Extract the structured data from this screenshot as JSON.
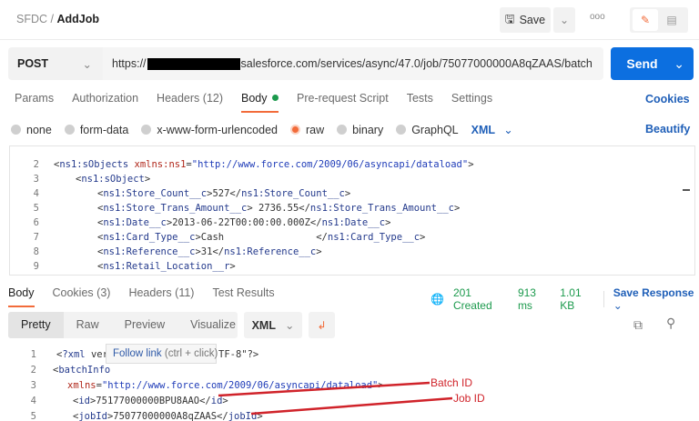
{
  "header": {
    "breadcrumb_parent": "SFDC",
    "breadcrumb_sep": "/",
    "title": "AddJob",
    "save_label": "Save"
  },
  "request": {
    "method": "POST",
    "url_prefix": "https://",
    "url_rest": "salesforce.com/services/async/47.0/job/75077000000A8qZAAS/batch",
    "send_label": "Send"
  },
  "tabs": {
    "params": "Params",
    "authorization": "Authorization",
    "headers": "Headers",
    "headers_count": "(12)",
    "body": "Body",
    "prerequest": "Pre-request Script",
    "tests": "Tests",
    "settings": "Settings",
    "cookies": "Cookies"
  },
  "body_types": {
    "none": "none",
    "form_data": "form-data",
    "urlencoded": "x-www-form-urlencoded",
    "raw": "raw",
    "binary": "binary",
    "graphql": "GraphQL",
    "language": "XML",
    "beautify": "Beautify",
    "selected": "raw"
  },
  "request_body": [
    {
      "n": "2",
      "t": "<ns1:sObjects xmlns:ns1=\"http://www.force.com/2009/06/asyncapi/dataload\">"
    },
    {
      "n": "3",
      "t": "<ns1:sObject>"
    },
    {
      "n": "4",
      "t": "<ns1:Store_Count__c>527</ns1:Store_Count__c>"
    },
    {
      "n": "5",
      "t": "<ns1:Store_Trans_Amount__c> 2736.55</ns1:Store_Trans_Amount__c>"
    },
    {
      "n": "6",
      "t": "<ns1:Date__c>2013-06-22T00:00:00.000Z</ns1:Date__c>"
    },
    {
      "n": "7",
      "t": "<ns1:Card_Type__c>Cash                </ns1:Card_Type__c>"
    },
    {
      "n": "8",
      "t": "<ns1:Reference__c>31</ns1:Reference__c>"
    },
    {
      "n": "9",
      "t": "<ns1:Retail_Location__r>"
    }
  ],
  "response_tabs": {
    "body": "Body",
    "cookies": "Cookies",
    "cookies_count": "(3)",
    "headers": "Headers",
    "headers_count": "(11)",
    "test_results": "Test Results"
  },
  "status": {
    "code": "201 Created",
    "time": "913 ms",
    "size": "1.01 KB",
    "save_response": "Save Response"
  },
  "response_view": {
    "pretty": "Pretty",
    "raw": "Raw",
    "preview": "Preview",
    "visualize": "Visualize",
    "language": "XML"
  },
  "response_body": [
    {
      "n": "1",
      "t": "<?xml vers"
    },
    {
      "n": "1b",
      "t": "TF-8\"?>"
    },
    {
      "n": "2",
      "t": "<batchInfo"
    },
    {
      "n": "3",
      "t": "xmlns=\"http://www.force.com/2009/06/asyncapi/dataload\">"
    },
    {
      "n": "4",
      "t": "<id>75177000000BPU8AAO</id>"
    },
    {
      "n": "5",
      "t": "<jobId>75077000000A8qZAAS</jobId>"
    }
  ],
  "tooltip": {
    "link": "Follow link",
    "hint": "(ctrl + click)"
  },
  "annotations": {
    "batch": "Batch ID",
    "job": "Job ID",
    "color": "#d0232a"
  },
  "colors": {
    "send": "#0c6fe0",
    "accent": "#f26b3a",
    "status": "#1c9a4d"
  }
}
